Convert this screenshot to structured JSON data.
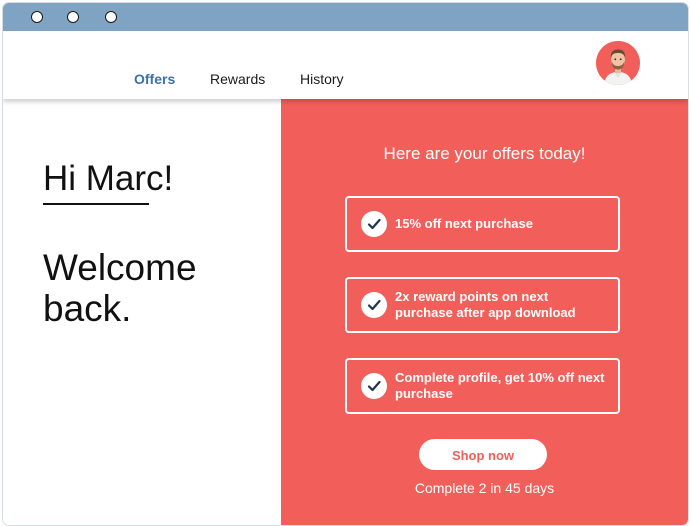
{
  "colors": {
    "titlebar": "#7ea3c3",
    "accent": "#f25f5a",
    "active_tab": "#3a6fb0"
  },
  "nav": {
    "tabs": [
      {
        "label": "Offers",
        "active": true
      },
      {
        "label": "Rewards",
        "active": false
      },
      {
        "label": "History",
        "active": false
      }
    ],
    "avatar_icon": "user-avatar-photo"
  },
  "welcome": {
    "greeting": "Hi Marc!",
    "message": "Welcome back."
  },
  "offers": {
    "heading": "Here are your offers today!",
    "items": [
      {
        "icon": "checkmark-icon",
        "text": "15% off next purchase"
      },
      {
        "icon": "checkmark-icon",
        "text": "2x reward points on next purchase after app download"
      },
      {
        "icon": "checkmark-icon",
        "text": "Complete profile, get 10% off next purchase"
      }
    ],
    "cta_label": "Shop now",
    "progress_note": "Complete 2 in 45 days"
  }
}
